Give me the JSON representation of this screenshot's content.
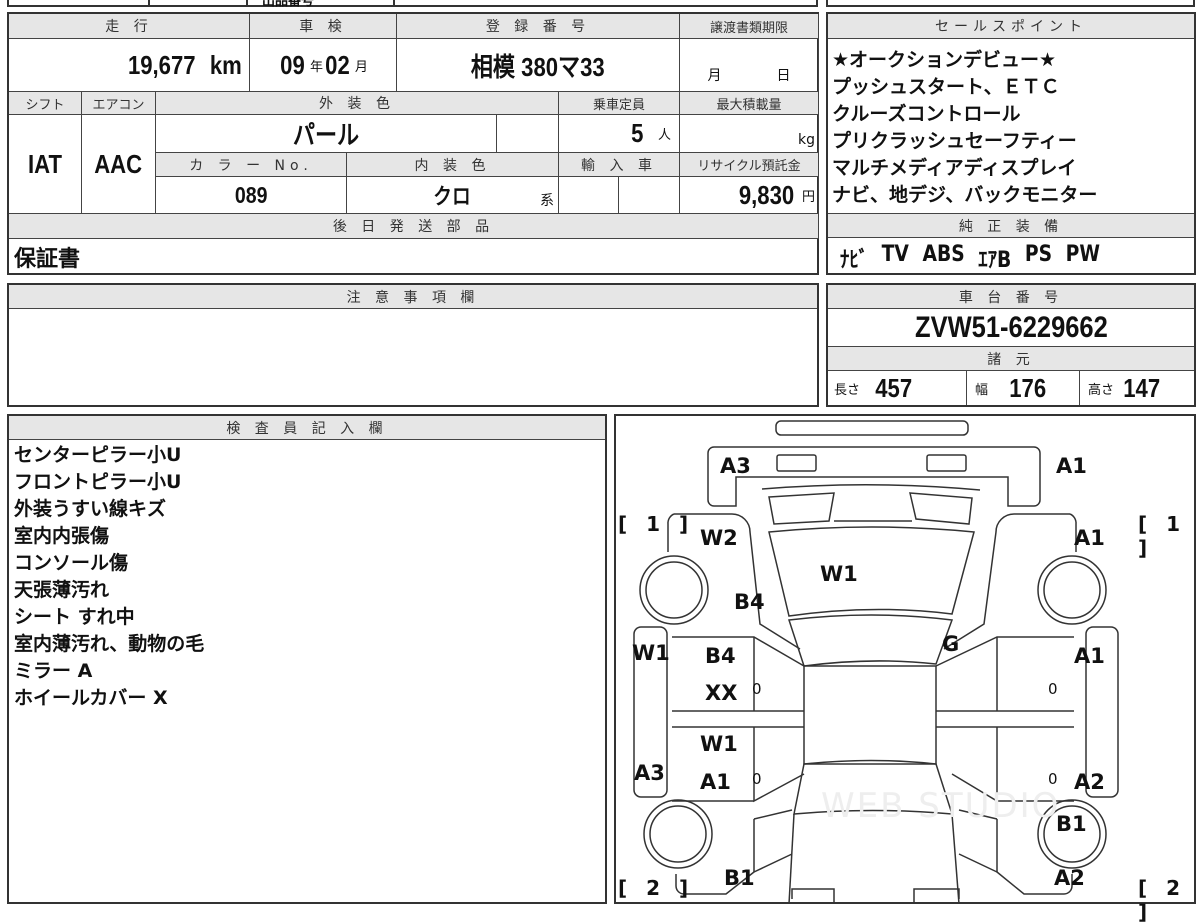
{
  "top_strip": {
    "partial_text": "出品番号"
  },
  "vehicle": {
    "mileage_header": "走 行",
    "mileage": "19,677",
    "mileage_unit": "km",
    "inspection_header": "車 検",
    "inspection_year": "09",
    "year_unit": "年",
    "inspection_month": "02",
    "month_unit": "月",
    "registration_header": "登 録 番 号",
    "registration": "相模 380マ33",
    "transfer_header": "譲渡書類期限",
    "transfer_month_unit": "月",
    "transfer_day_unit": "日",
    "shift_header": "シフト",
    "shift": "IAT",
    "ac_header": "エアコン",
    "ac": "AAC",
    "exterior_header": "外 装 色",
    "exterior": "パール",
    "capacity_header": "乗車定員",
    "capacity": "5",
    "capacity_unit": "人",
    "max_load_header": "最大積載量",
    "max_load_unit": "kg",
    "color_no_header": "カ ラ ー No.",
    "color_no": "089",
    "interior_header": "内 装 色",
    "interior": "クロ",
    "interior_suffix": "系",
    "import_header": "輸 入 車",
    "recycle_header": "リサイクル預託金",
    "recycle": "9,830",
    "recycle_unit": "円",
    "later_parts_header": "後 日 発 送 部 品",
    "later_parts": "保証書"
  },
  "sales_points": {
    "header": "セールスポイント",
    "lines": [
      "★オークションデビュー★",
      "プッシュスタート、ＥＴＣ",
      "クルーズコントロール",
      "プリクラッシュセーフティー",
      "マルチメディアディスプレイ",
      "ナビ、地デジ、バックモニター"
    ]
  },
  "equipment": {
    "header": "純 正 装 備",
    "items": [
      "ﾅﾋﾞ",
      "TV",
      "ABS",
      "ｴｱB",
      "PS",
      "PW"
    ]
  },
  "notes": {
    "header": "注 意 事 項 欄"
  },
  "chassis": {
    "header": "車 台 番 号",
    "number": "ZVW51-6229662",
    "spec_header": "諸 元",
    "length_label": "長さ",
    "length": "457",
    "width_label": "幅",
    "width": "176",
    "height_label": "高さ",
    "height": "147"
  },
  "inspector": {
    "header": "検 査 員 記 入 欄",
    "lines": [
      "センターピラー小U",
      "フロントピラー小U",
      "外装うすい線キズ",
      "室内内張傷",
      "コンソール傷",
      "天張薄汚れ",
      "シート すれ中",
      "室内薄汚れ、動物の毛",
      "ミラー A",
      "ホイールカバー X"
    ]
  },
  "diagram": {
    "labels": {
      "front_left": "A3",
      "front_right": "A1",
      "fender_left": "W2",
      "fender_right": "A1",
      "windshield": "W1",
      "pillar_left": "B4",
      "roof": "G",
      "step_left": "W1",
      "front_door_left_1": "B4",
      "front_door_left_2": "XX",
      "front_door_right": "A1",
      "rear_door_left_1": "W1",
      "rear_door_left_2": "A1",
      "step_left_2": "A3",
      "rear_door_right": "A2",
      "quarter_right": "B1",
      "rear_left": "B1",
      "rear_right": "A2",
      "zero": "0",
      "tire_front": "[ 1 ]",
      "tire_rear": "[ 2 ]"
    },
    "watermark": "WEB STUDIO"
  }
}
